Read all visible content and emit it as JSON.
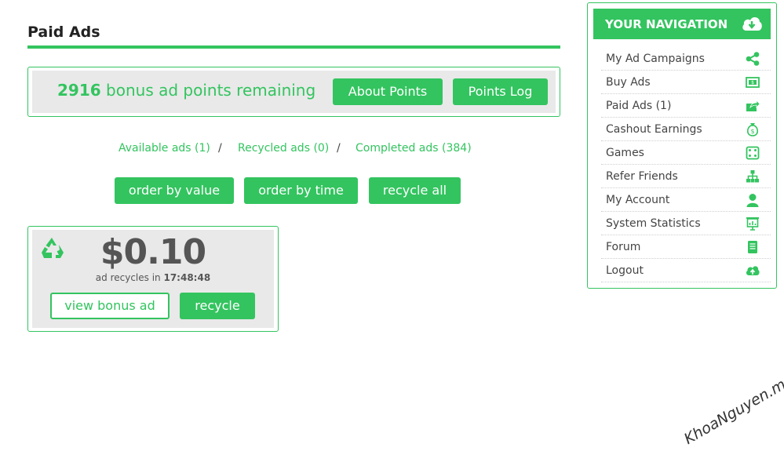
{
  "header": {
    "title": "Paid Ads"
  },
  "points": {
    "count": "2916",
    "text": "bonus ad points remaining",
    "about_label": "About Points",
    "log_label": "Points Log"
  },
  "filters": [
    {
      "label": "Available ads (1)"
    },
    {
      "label": "Recycled ads (0)"
    },
    {
      "label": "Completed ads (384)"
    }
  ],
  "filter_separator": "/",
  "sort_buttons": {
    "by_value": "order by value",
    "by_time": "order by time",
    "recycle_all": "recycle all"
  },
  "ad": {
    "value": "$0.10",
    "recycle_prefix": "ad recycles in",
    "recycle_time": "17:48:48",
    "view_label": "view bonus ad",
    "recycle_label": "recycle",
    "icon": "recycle-icon"
  },
  "nav": {
    "title": "YOUR NAVIGATION",
    "title_icon": "cloud-download-icon",
    "items": [
      {
        "label": "My Ad Campaigns",
        "icon": "share-icon"
      },
      {
        "label": "Buy Ads",
        "icon": "money-bill-icon"
      },
      {
        "label": "Paid Ads (1)",
        "icon": "share-box-icon"
      },
      {
        "label": "Cashout Earnings",
        "icon": "money-bag-icon"
      },
      {
        "label": "Games",
        "icon": "dice-icon"
      },
      {
        "label": "Refer Friends",
        "icon": "sitemap-icon"
      },
      {
        "label": "My Account",
        "icon": "user-icon"
      },
      {
        "label": "System Statistics",
        "icon": "presentation-icon"
      },
      {
        "label": "Forum",
        "icon": "book-icon"
      },
      {
        "label": "Logout",
        "icon": "cloud-upload-icon"
      }
    ]
  },
  "watermark": "KhoaNguyen.me",
  "colors": {
    "accent": "#33c45f",
    "panel_bg": "#e9e9e9",
    "text": "#444444"
  }
}
